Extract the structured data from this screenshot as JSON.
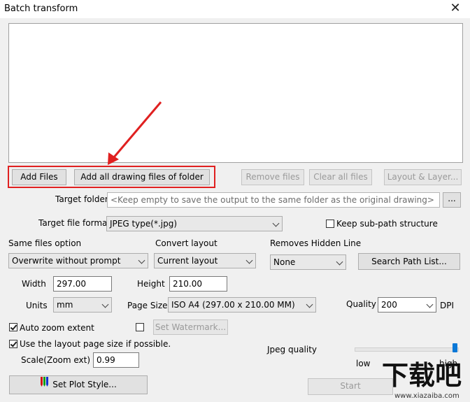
{
  "window": {
    "title": "Batch transform",
    "close_glyph": "✕"
  },
  "buttons": {
    "add_files": "Add Files",
    "add_folder": "Add all drawing files of folder",
    "remove_files": "Remove files",
    "clear_all_files": "Clear all files",
    "layout_layer": "Layout & Layer...",
    "browse": "...",
    "search_path_list": "Search Path List...",
    "set_watermark": "Set Watermark...",
    "set_plot_style": "Set Plot Style...",
    "start": "Start"
  },
  "target_folder": {
    "label": "Target folder",
    "placeholder": "<Keep empty to save the output to the same folder as the original drawing>"
  },
  "target_format": {
    "label": "Target file format",
    "value": "JPEG type(*.jpg)"
  },
  "keep_subpath": {
    "label": "Keep sub-path structure",
    "checked": false
  },
  "same_files_option": {
    "label": "Same files option",
    "value": "Overwrite without prompt"
  },
  "convert_layout": {
    "label": "Convert layout",
    "value": "Current layout"
  },
  "removes_hidden_line": {
    "label": "Removes Hidden Line",
    "value": "None"
  },
  "width": {
    "label": "Width",
    "value": "297.00"
  },
  "height": {
    "label": "Height",
    "value": "210.00"
  },
  "units": {
    "label": "Units",
    "value": "mm"
  },
  "page_size": {
    "label": "Page Size",
    "value": "ISO A4 (297.00 x 210.00 MM)"
  },
  "quality": {
    "label": "Quality",
    "value": "200",
    "unit": "DPI"
  },
  "auto_zoom": {
    "label": "Auto zoom extent",
    "checked": true
  },
  "watermark_checkbox": {
    "checked": false
  },
  "layout_page_size": {
    "label": "Use the layout page size if possible.",
    "checked": true
  },
  "scale": {
    "label": "Scale(Zoom ext)",
    "value": "0.99"
  },
  "jpeg_quality": {
    "label": "Jpeg quality",
    "low": "low",
    "high": "high",
    "level_percent": 100
  },
  "watermark_logo": {
    "text": "下载吧",
    "site": "www.xiazaiba.com"
  },
  "colors": {
    "highlight": "#e02020",
    "slider": "#0a78d7"
  },
  "icons": {
    "close": "close-icon",
    "plot_style": "pens-icon",
    "dropdown": "chevron-down-icon"
  }
}
